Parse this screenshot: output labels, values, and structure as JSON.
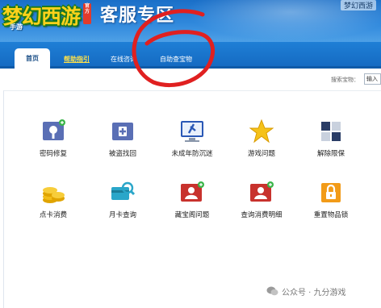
{
  "header": {
    "logo_text": "梦幻西游",
    "logo_subtitle": "手游",
    "logo_badge": "官方",
    "title": "客服专区",
    "top_right_text": "梦幻西游"
  },
  "nav": {
    "items": [
      {
        "label": "首页",
        "active": true
      },
      {
        "label": "帮助指引",
        "highlight": true
      },
      {
        "label": "在线咨询"
      },
      {
        "label": "自助查宝物"
      }
    ]
  },
  "search": {
    "label": "搜索宝物：",
    "value": "输入"
  },
  "services": {
    "row1": [
      {
        "label": "密码修复",
        "icon": "lock-key-icon"
      },
      {
        "label": "被盗找回",
        "icon": "medical-kit-icon"
      },
      {
        "label": "未成年防沉迷",
        "icon": "monitor-icon"
      },
      {
        "label": "游戏问题",
        "icon": "star-icon"
      },
      {
        "label": "解除限保",
        "icon": "grid-block-icon"
      }
    ],
    "row2": [
      {
        "label": "点卡消费",
        "icon": "coins-icon"
      },
      {
        "label": "月卡查询",
        "icon": "card-search-icon"
      },
      {
        "label": "藏宝阁问题",
        "icon": "user-card-icon"
      },
      {
        "label": "查询消费明细",
        "icon": "user-card-check-icon"
      },
      {
        "label": "重置物品锁",
        "icon": "padlock-icon"
      }
    ]
  },
  "watermark": {
    "text": "公众号 · 九分游戏"
  },
  "colors": {
    "header_blue": "#1a6fc8",
    "nav_blue": "#156bc2",
    "annotation_red": "#e02020",
    "logo_yellow": "#ffd21a"
  }
}
